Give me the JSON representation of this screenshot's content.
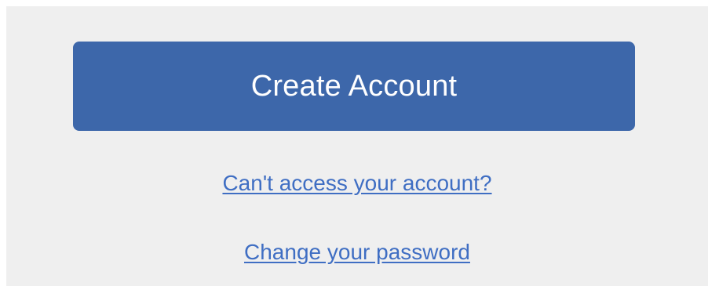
{
  "actions": {
    "create_account_label": "Create Account"
  },
  "links": {
    "cant_access_label": "Can't access your account?",
    "change_password_label": "Change your password"
  },
  "colors": {
    "button_bg": "#3d67aa",
    "link_color": "#3f6ec3",
    "panel_bg": "#efefef"
  }
}
